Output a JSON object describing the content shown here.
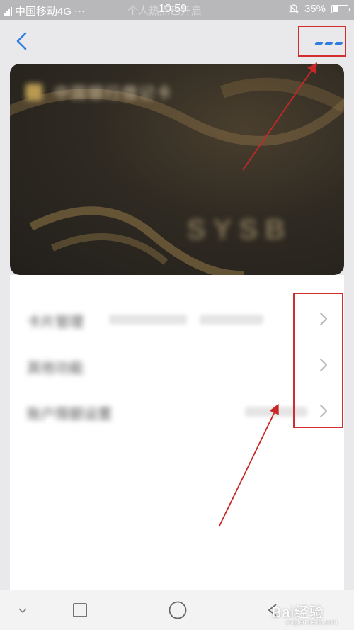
{
  "status_bar": {
    "carrier": "中国移动4G",
    "extra": "···",
    "faint_text": "个人热点已开启",
    "time": "10:59",
    "battery": "35%",
    "battery_level": 0.35
  },
  "header": {
    "back_icon": "chevron-left-icon",
    "more_icon": "more-icon"
  },
  "card": {
    "name": "中国银行借记卡",
    "brand": "SYSB"
  },
  "details": {
    "rows": [
      {
        "label": "卡片管理",
        "value": "",
        "value2": ""
      },
      {
        "label": "其他功能",
        "value": "",
        "value2": ""
      },
      {
        "label": "账户限额设置",
        "value": "",
        "value2": ""
      }
    ]
  },
  "watermark": {
    "text": "Bai经验",
    "sub": "jingyan.baidu.com"
  },
  "colors": {
    "accent": "#2f7de1",
    "annotation": "#d32d2d"
  }
}
